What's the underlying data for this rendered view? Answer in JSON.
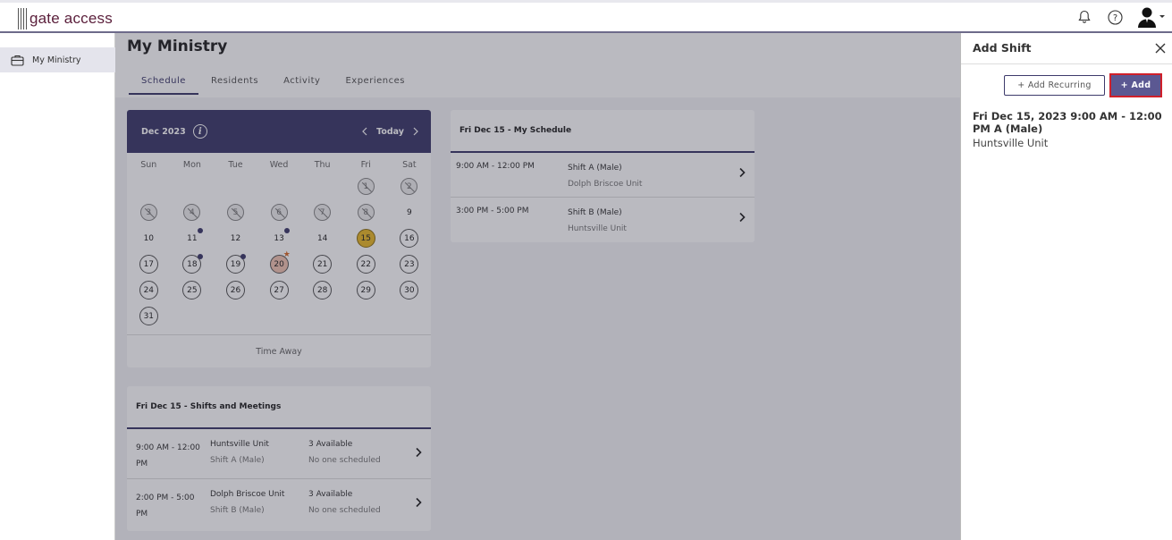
{
  "app": {
    "logo_text": "gate access"
  },
  "topbar": {
    "icons": [
      "bell-icon",
      "help-icon",
      "user-avatar-icon",
      "caret-down-icon"
    ]
  },
  "sidebar": {
    "items": [
      {
        "label": "My Ministry",
        "icon": "briefcase-icon"
      }
    ]
  },
  "page": {
    "title": "My Ministry",
    "tabs": [
      {
        "label": "Schedule",
        "active": true
      },
      {
        "label": "Residents",
        "active": false
      },
      {
        "label": "Activity",
        "active": false
      },
      {
        "label": "Experiences",
        "active": false
      }
    ]
  },
  "calendar": {
    "month_label": "Dec 2023",
    "today_label": "Today",
    "weekdays": [
      "Sun",
      "Mon",
      "Tue",
      "Wed",
      "Thu",
      "Fri",
      "Sat"
    ],
    "time_away_label": "Time Away",
    "accent": "#3d3a6b",
    "today_color": "#e9b928"
  },
  "my_schedule": {
    "title": "Fri Dec 15 - My Schedule",
    "rows": [
      {
        "time": "9:00 AM - 12:00 PM",
        "shift": "Shift A (Male)",
        "unit": "Dolph Briscoe Unit"
      },
      {
        "time": "3:00 PM - 5:00 PM",
        "shift": "Shift B (Male)",
        "unit": "Huntsville Unit"
      }
    ]
  },
  "shifts_meetings": {
    "title": "Fri Dec 15 - Shifts and Meetings",
    "rows": [
      {
        "time": "9:00 AM - 12:00 PM",
        "unit": "Huntsville Unit",
        "shift": "Shift A (Male)",
        "available": "3 Available",
        "scheduled": "No one scheduled"
      },
      {
        "time": "2:00 PM - 5:00 PM",
        "unit": "Dolph Briscoe Unit",
        "shift": "Shift B (Male)",
        "available": "3 Available",
        "scheduled": "No one scheduled"
      }
    ]
  },
  "panel": {
    "title": "Add Shift",
    "add_recurring_label": "+ Add Recurring",
    "add_label": "+ Add",
    "shift_heading": "Fri Dec 15, 2023 9:00 AM - 12:00 PM A (Male)",
    "shift_location": "Huntsville Unit"
  }
}
